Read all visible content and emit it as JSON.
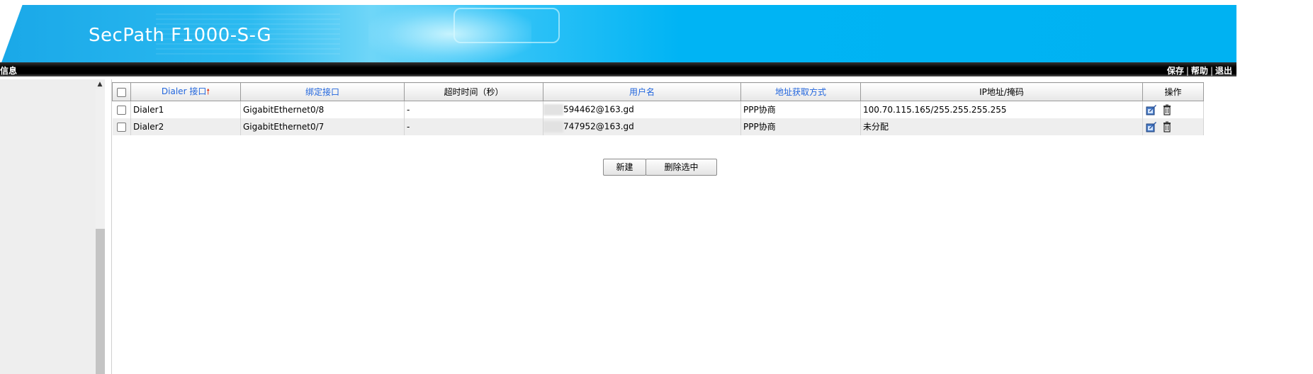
{
  "header": {
    "product_title": "SecPath F1000-S-G"
  },
  "topbar": {
    "left_text": "信息",
    "links": [
      {
        "label": "保存"
      },
      {
        "label": "帮助"
      },
      {
        "label": "退出"
      }
    ],
    "separator": "|"
  },
  "table": {
    "columns": [
      {
        "label": "Dialer 接口",
        "sortable": true,
        "sorted": "asc"
      },
      {
        "label": "绑定接口",
        "sortable": true
      },
      {
        "label": "超时时间（秒）",
        "sortable": false
      },
      {
        "label": "用户名",
        "sortable": true
      },
      {
        "label": "地址获取方式",
        "sortable": true
      },
      {
        "label": "IP地址/掩码",
        "sortable": false
      },
      {
        "label": "操作",
        "sortable": false
      }
    ],
    "sort_arrow": "🠕",
    "rows": [
      {
        "dialer": "Dialer1",
        "bind": "GigabitEthernet0/8",
        "timeout": "-",
        "username": "594462@163.gd",
        "method": "PPP协商",
        "ip": "100.70.115.165/255.255.255.255"
      },
      {
        "dialer": "Dialer2",
        "bind": "GigabitEthernet0/7",
        "timeout": "-",
        "username": "747952@163.gd",
        "method": "PPP协商",
        "ip": "未分配"
      }
    ]
  },
  "buttons": {
    "new_label": "新建",
    "delete_label": "删除选中"
  },
  "icons": {
    "edit": "edit-icon",
    "delete": "trash-icon",
    "scroll_up": "scroll-up-arrow-icon"
  },
  "colors": {
    "header_blue": "#00b2f2",
    "link_blue": "#2266dd",
    "sort_arrow": "#e03010"
  }
}
